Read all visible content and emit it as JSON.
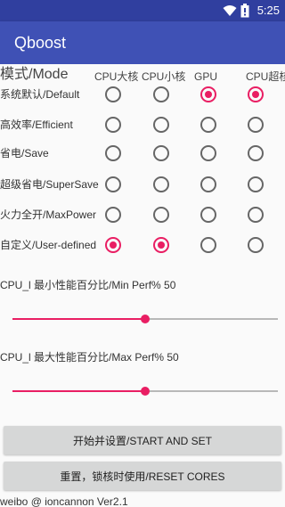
{
  "status_bar": {
    "time": "5:25",
    "icons": [
      "wifi-icon",
      "battery-icon"
    ]
  },
  "app_bar": {
    "title": "Qboost"
  },
  "table": {
    "mode_header": "模式/Mode",
    "columns": [
      "CPU大核",
      "CPU小核",
      "GPU",
      "CPU超核"
    ],
    "rows": [
      {
        "label": "系统默认/Default",
        "checked": [
          false,
          false,
          true,
          true
        ]
      },
      {
        "label": "高效率/Efficient",
        "checked": [
          false,
          false,
          false,
          false
        ]
      },
      {
        "label": "省电/Save",
        "checked": [
          false,
          false,
          false,
          false
        ]
      },
      {
        "label": "超级省电/SuperSave",
        "checked": [
          false,
          false,
          false,
          false
        ]
      },
      {
        "label": "火力全开/MaxPower",
        "checked": [
          false,
          false,
          false,
          false
        ]
      },
      {
        "label": "自定义/User-defined",
        "checked": [
          true,
          true,
          false,
          false
        ]
      }
    ]
  },
  "sliders": {
    "min_perf": {
      "label": "CPU_l 最小性能百分比/Min Perf% 50",
      "value_percent": 50
    },
    "max_perf": {
      "label": "CPU_l 最大性能百分比/Max Perf% 50",
      "value_percent": 50
    }
  },
  "buttons": {
    "start_and_set": "开始并设置/START AND SET",
    "reset_cores": "重置，锁核时使用/RESET CORES"
  },
  "footer": {
    "text": "weibo @ ioncannon Ver2.1"
  },
  "colors": {
    "primary": "#3f51b5",
    "primary_dark": "#303f9f",
    "accent": "#e91e63"
  }
}
